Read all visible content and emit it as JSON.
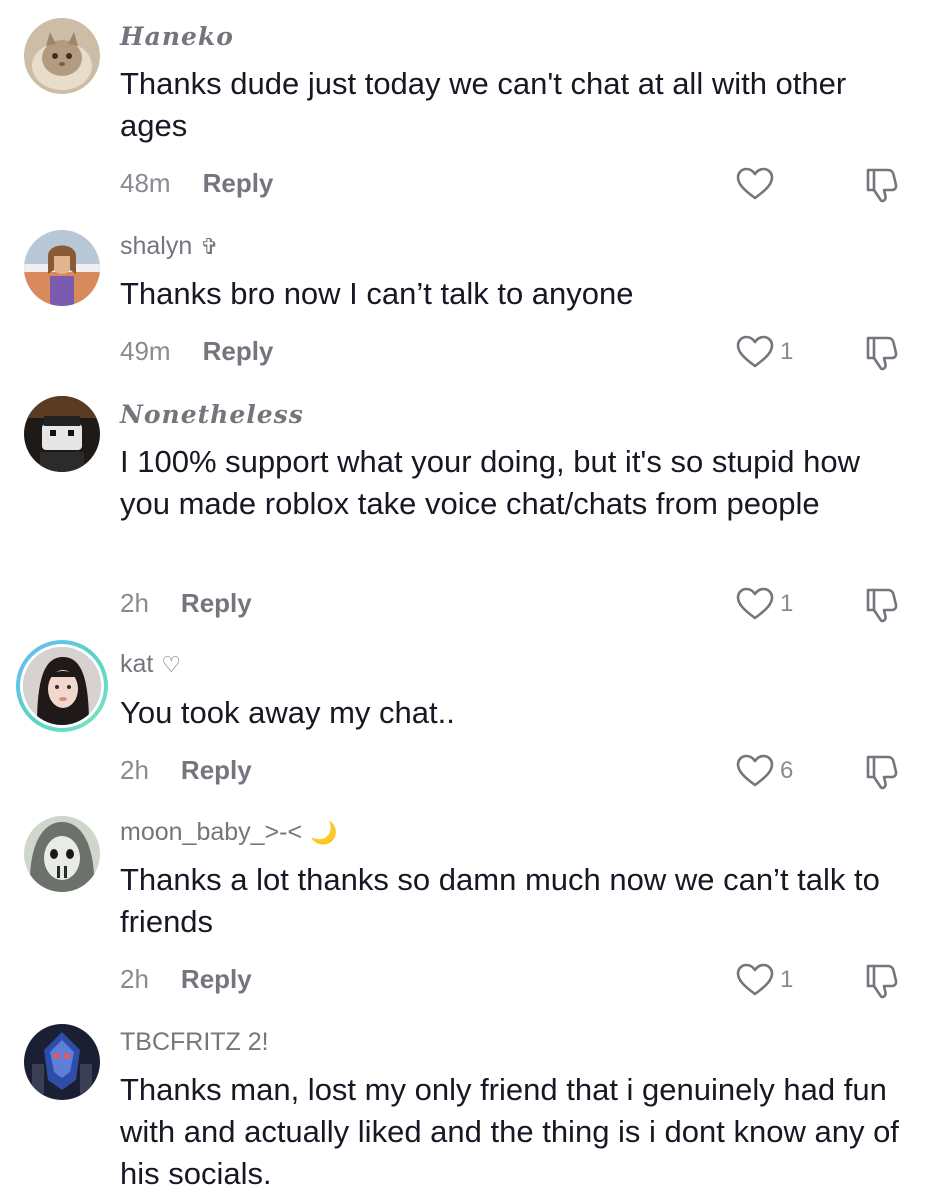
{
  "comments": [
    {
      "username": "Haneko",
      "username_suffix": "",
      "text": "Thanks dude just today we can't chat at all with other ages",
      "time": "48m",
      "reply_label": "Reply",
      "likes": "",
      "avatar": "cat-photo"
    },
    {
      "username": "shalyn",
      "username_suffix": "✞",
      "text": "Thanks bro now I can’t talk to anyone",
      "time": "49m",
      "reply_label": "Reply",
      "likes": "1",
      "avatar": "girl-photo"
    },
    {
      "username": "Nonetheless",
      "username_suffix": "",
      "text": "I 100% support what your doing, but it's so stupid how you made roblox take voice chat/chats from people",
      "time": "2h",
      "reply_label": "Reply",
      "likes": "1",
      "avatar": "roblox-avatar"
    },
    {
      "username": "kat",
      "username_suffix": "♡",
      "text": "You took away my chat..",
      "time": "2h",
      "reply_label": "Reply",
      "likes": "6",
      "avatar": "selfie-photo"
    },
    {
      "username": "moon_baby_>-<",
      "username_suffix": "🌙",
      "text": "Thanks a lot thanks so damn much now we can’t talk to friends",
      "time": "2h",
      "reply_label": "Reply",
      "likes": "1",
      "avatar": "bw-face-art"
    },
    {
      "username": "TBCFRITZ 2!",
      "username_suffix": "",
      "text": "Thanks man, lost my only friend that i genuinely had fun with and actually liked and the thing is i dont know any of his socials.",
      "time": "",
      "reply_label": "",
      "likes": "",
      "avatar": "robot-character"
    }
  ],
  "icons": {
    "like": "heart-outline-icon",
    "dislike": "thumbs-down-icon"
  },
  "colors": {
    "username": "#75767d",
    "meta": "#8a8b91",
    "text": "#161823",
    "story_ring": "#6ab8ff"
  }
}
